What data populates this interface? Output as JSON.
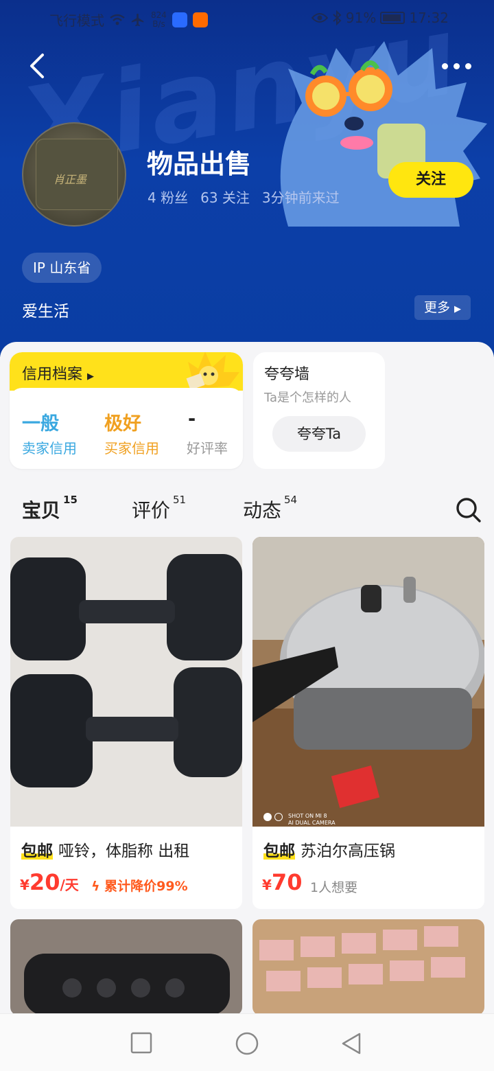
{
  "status_bar": {
    "airplane_mode": "飞行模式",
    "net_speed_value": "824",
    "net_speed_unit": "B/s",
    "battery": "91%",
    "time": "17:32"
  },
  "header": {
    "watermark": "Xianyu",
    "shop_name": "物品出售",
    "fans": "4 粉丝",
    "following": "63 关注",
    "last_seen": "3分钟前来过",
    "follow_button": "关注",
    "ip_location": "IP 山东省",
    "bio": "爱生活",
    "more_button": "更多",
    "avatar_text": "肖正墨"
  },
  "credit": {
    "title": "信用档案",
    "seller_value": "一般",
    "seller_label": "卖家信用",
    "buyer_value": "极好",
    "buyer_label": "买家信用",
    "rate_value": "-",
    "rate_label": "好评率"
  },
  "praise_wall": {
    "title": "夸夸墙",
    "subtitle": "Ta是个怎样的人",
    "button": "夸夸Ta"
  },
  "tabs": [
    {
      "label": "宝贝",
      "count": "15"
    },
    {
      "label": "评价",
      "count": "51"
    },
    {
      "label": "动态",
      "count": "54"
    }
  ],
  "items": [
    {
      "badge": "包邮",
      "title": "哑铃，体脂称 出租",
      "currency": "¥",
      "price": "20",
      "unit": "/天",
      "note": "累计降价99%"
    },
    {
      "badge": "包邮",
      "title": "苏泊尔高压锅",
      "currency": "¥",
      "price": "70",
      "want": "1人想要",
      "camera_text_1": "SHOT ON MI 8",
      "camera_text_2": "AI DUAL CAMERA"
    }
  ],
  "colors": {
    "header_blue": "#0c3fa8",
    "accent_yellow": "#ffe11b",
    "price_red": "#ff3b2f",
    "seller_blue": "#3aa8e0",
    "buyer_orange": "#f0a020"
  }
}
